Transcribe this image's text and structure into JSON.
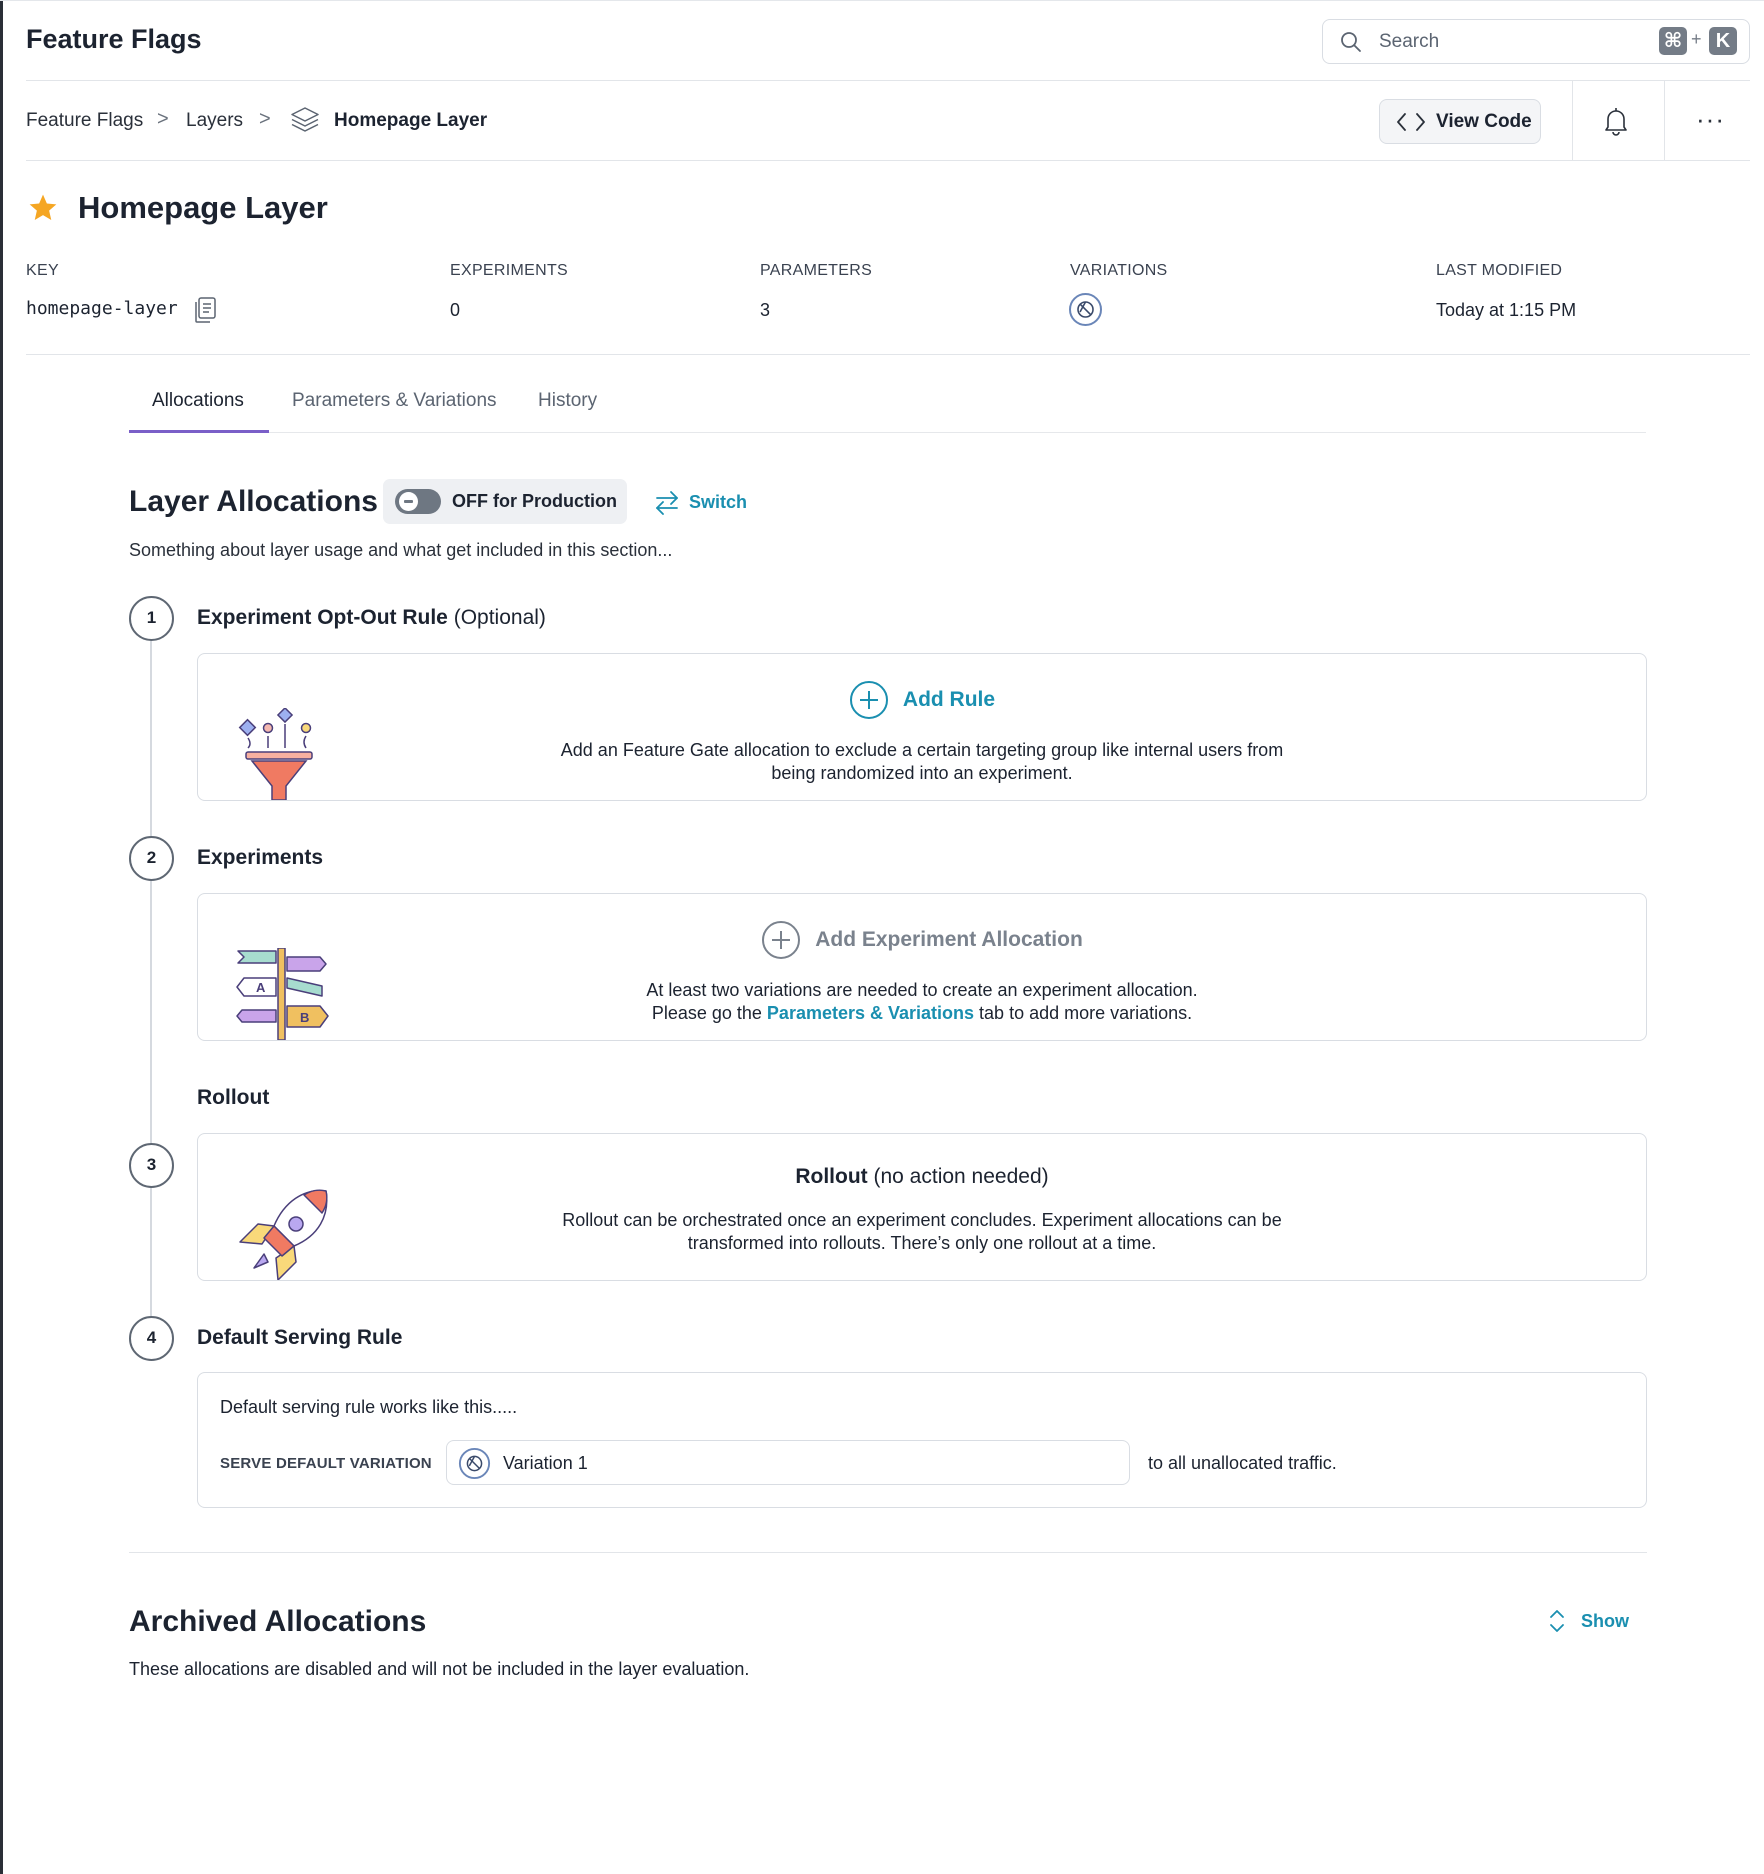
{
  "header": {
    "app_title": "Feature Flags",
    "search_placeholder": "Search",
    "shortcut_modifier": "⌘",
    "shortcut_plus": "+",
    "shortcut_key": "K",
    "more_label": "···"
  },
  "breadcrumb": {
    "items": [
      "Feature Flags",
      "Layers",
      "Homepage Layer"
    ],
    "separator": ">"
  },
  "toolbar": {
    "view_code_label": "View Code"
  },
  "page": {
    "title": "Homepage Layer",
    "starred": true
  },
  "meta": {
    "key_label": "KEY",
    "key_value": "homepage-layer",
    "experiments_label": "EXPERIMENTS",
    "experiments_value": "0",
    "parameters_label": "PARAMETERS",
    "parameters_value": "3",
    "variations_label": "VARIATIONS",
    "last_modified_label": "LAST MODIFIED",
    "last_modified_value": "Today at 1:15 PM"
  },
  "tabs": [
    {
      "label": "Allocations",
      "active": true
    },
    {
      "label": "Parameters & Variations",
      "active": false
    },
    {
      "label": "History",
      "active": false
    }
  ],
  "layer_allocations": {
    "title": "Layer Allocations",
    "toggle_label": "OFF for Production",
    "toggle_on": false,
    "switch_label": "Switch",
    "description": "Something about layer usage and what get included in this section..."
  },
  "steps": {
    "opt_out": {
      "number": "1",
      "title": "Experiment Opt-Out Rule",
      "optional": "(Optional)",
      "add_label": "Add Rule",
      "text_line1": "Add an Feature Gate allocation to exclude a certain targeting group like internal users from",
      "text_line2": "being randomized into an experiment."
    },
    "experiments": {
      "number": "2",
      "title": "Experiments",
      "add_label": "Add Experiment Allocation",
      "text_line1": "At least two variations are needed to create an experiment allocation.",
      "text_line2_prefix": "Please go the",
      "text_line2_link": "Parameters & Variations",
      "text_line2_suffix": "tab to add more variations.",
      "sign_a": "A",
      "sign_b": "B"
    },
    "rollout": {
      "number": "3",
      "title": "Rollout",
      "head_bold": "Rollout",
      "head_rest": "(no action needed)",
      "text_line1": "Rollout can be orchestrated once an experiment concludes. Experiment allocations can be",
      "text_line2": "transformed into rollouts. There’s only one rollout at a time."
    },
    "default": {
      "number": "4",
      "title": "Default Serving Rule",
      "description": "Default serving rule works like this.....",
      "serve_label": "SERVE DEFAULT VARIATION",
      "serve_value": "Variation 1",
      "serve_tail": "to all unallocated traffic."
    }
  },
  "archived": {
    "title": "Archived Allocations",
    "show_label": "Show",
    "description": "These allocations are disabled and will not be included in the layer evaluation."
  },
  "colors": {
    "accent_teal": "#1a8fb0",
    "tab_active": "#7a5fc8",
    "star": "#f5a623"
  }
}
